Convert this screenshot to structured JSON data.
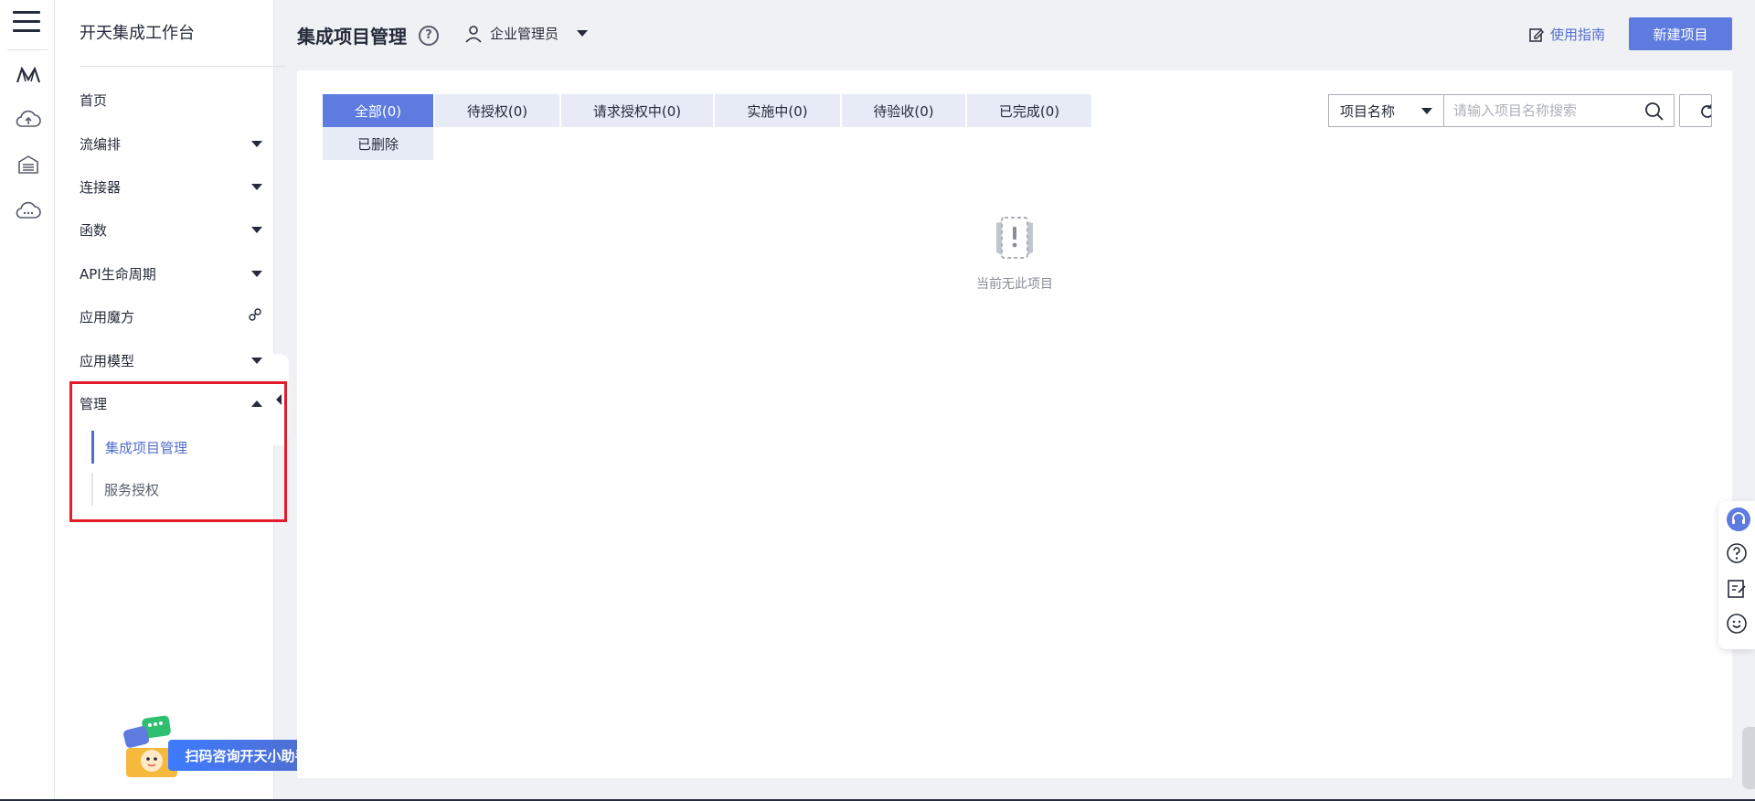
{
  "rail": {
    "icons": [
      "menu-icon",
      "flow-logo-icon",
      "cloud-upload-icon",
      "warehouse-icon",
      "cloud-chat-icon"
    ]
  },
  "sidebar": {
    "title": "开天集成工作台",
    "items": [
      {
        "label": "首页"
      },
      {
        "label": "流编排"
      },
      {
        "label": "连接器"
      },
      {
        "label": "函数"
      },
      {
        "label": "API生命周期"
      },
      {
        "label": "应用魔方"
      },
      {
        "label": "应用模型"
      },
      {
        "label": "管理"
      }
    ],
    "sub_items": [
      {
        "label": "集成项目管理",
        "active": true
      },
      {
        "label": "服务授权",
        "active": false
      }
    ],
    "assistant_label": "扫码咨询开天小助手"
  },
  "header": {
    "title": "集成项目管理",
    "user_role": "企业管理员",
    "guide_label": "使用指南",
    "new_project_label": "新建项目"
  },
  "tabs": [
    {
      "label": "全部(0)",
      "active": true
    },
    {
      "label": "待授权(0)"
    },
    {
      "label": "请求授权中(0)"
    },
    {
      "label": "实施中(0)"
    },
    {
      "label": "待验收(0)"
    },
    {
      "label": "已完成(0)"
    },
    {
      "label": "已删除"
    }
  ],
  "search": {
    "field_label": "项目名称",
    "placeholder": "请输入项目名称搜索"
  },
  "empty_state": {
    "text": "当前无此项目"
  },
  "colors": {
    "accent": "#5e7ce0",
    "highlight": "#e21c2b",
    "tab_bg": "#e7ebf5"
  }
}
